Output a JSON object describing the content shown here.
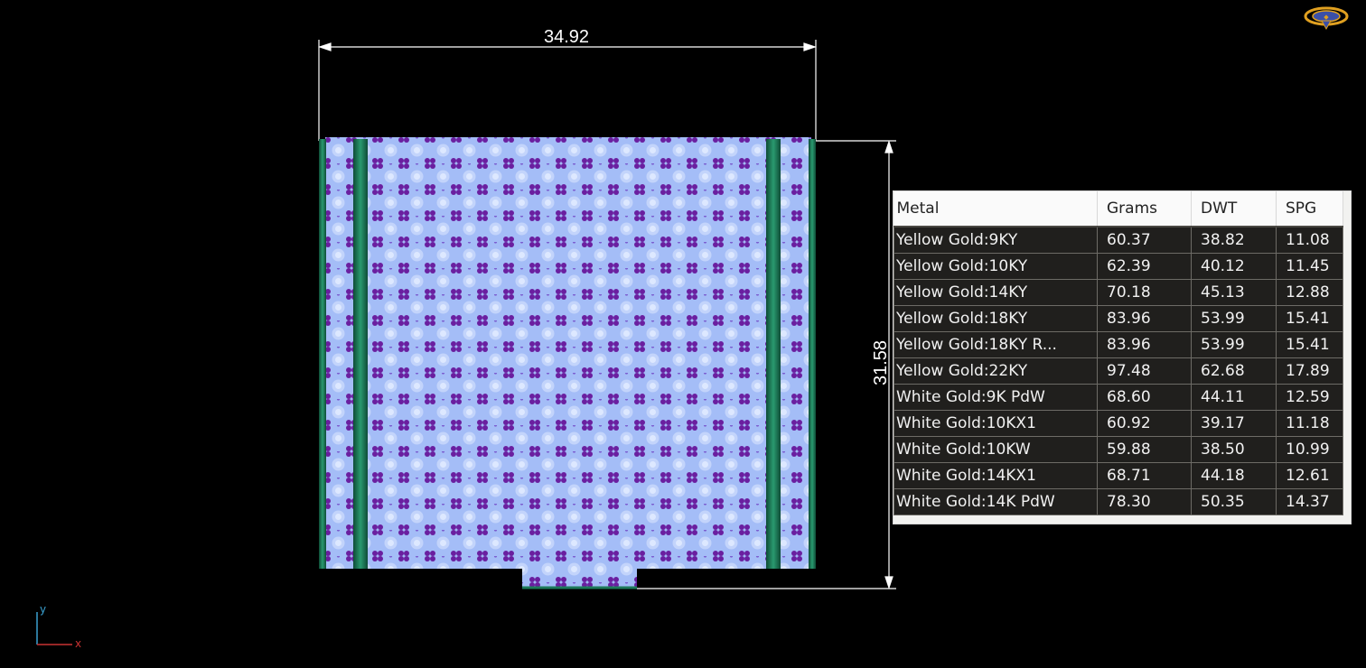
{
  "dimensions": {
    "width": "34.92",
    "height": "31.58"
  },
  "metal_table": {
    "headers": [
      "Metal",
      "Grams",
      "DWT",
      "SPG"
    ],
    "rows": [
      [
        "Yellow Gold:9KY",
        "60.37",
        "38.82",
        "11.08"
      ],
      [
        "Yellow Gold:10KY",
        "62.39",
        "40.12",
        "11.45"
      ],
      [
        "Yellow Gold:14KY",
        "70.18",
        "45.13",
        "12.88"
      ],
      [
        "Yellow Gold:18KY",
        "83.96",
        "53.99",
        "15.41"
      ],
      [
        "Yellow Gold:18KY R...",
        "83.96",
        "53.99",
        "15.41"
      ],
      [
        "Yellow Gold:22KY",
        "97.48",
        "62.68",
        "17.89"
      ],
      [
        "White Gold:9K PdW",
        "68.60",
        "44.11",
        "12.59"
      ],
      [
        "White Gold:10KX1",
        "60.92",
        "39.17",
        "11.18"
      ],
      [
        "White Gold:10KW",
        "59.88",
        "38.50",
        "10.99"
      ],
      [
        "White Gold:14KX1",
        "68.71",
        "44.18",
        "12.61"
      ],
      [
        "White Gold:14K PdW",
        "78.30",
        "50.35",
        "14.37"
      ]
    ]
  },
  "axis": {
    "x": "x",
    "y": "y"
  },
  "colors": {
    "background": "#000000",
    "metal_surface": "#a4bdf7",
    "gem_prong": "#6a1fa0",
    "side_rail": "#1d7a5a",
    "axis_x": "#c83232",
    "axis_y": "#3aa0d0",
    "logo_gold": "#e0a020"
  },
  "icons": {
    "logo": "app-logo-icon",
    "axis": "axis-triad-icon"
  }
}
